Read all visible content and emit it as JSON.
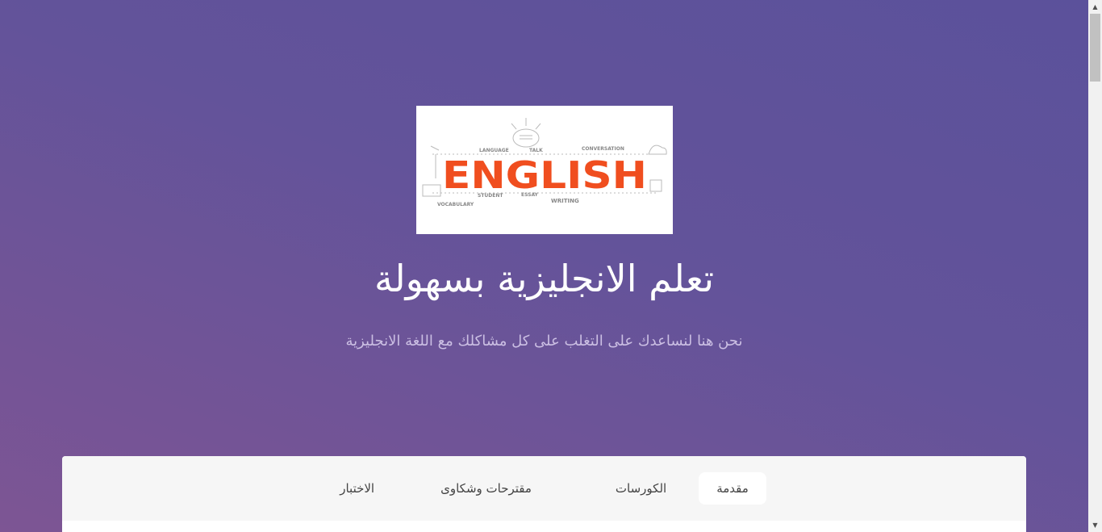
{
  "hero": {
    "logo_image": {
      "main_word": "ENGLISH",
      "labels": [
        "LANGUAGE",
        "TALK",
        "CONVERSATION",
        "STUDENT",
        "ESSAY",
        "WRITING",
        "VOCABULARY"
      ],
      "accent": "#f04e1f"
    },
    "title": "تعلم الانجليزية بسهولة",
    "subtitle": "نحن هنا لنساعدك على التغلب على كل مشاكلك مع اللغة الانجليزية"
  },
  "tabs": [
    {
      "label": "مقدمة",
      "active": true
    },
    {
      "label": "الكورسات",
      "active": false
    },
    {
      "label": "مقترحات وشكاوى",
      "active": false
    },
    {
      "label": "الاختبار",
      "active": false
    }
  ]
}
